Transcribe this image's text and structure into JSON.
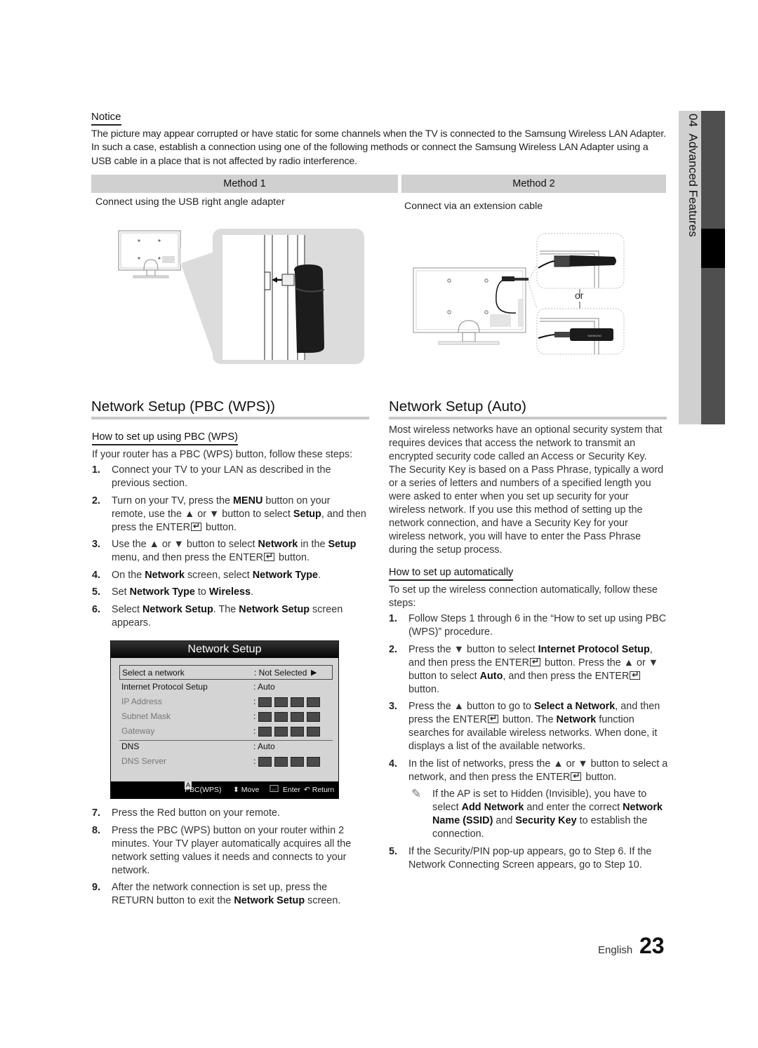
{
  "notice": {
    "title": "Notice",
    "text": "The picture may appear corrupted or have static for some channels when the TV is connected to the Samsung Wireless LAN Adapter. In such a case, establish a connection using one of the following methods or connect the Samsung Wireless LAN Adapter using a USB cable in a place that is not affected by radio interference."
  },
  "methods": [
    {
      "label": "Method 1",
      "desc": "Connect using the USB right angle adapter"
    },
    {
      "label": "Method 2",
      "desc": "Connect via an extension cable",
      "or_label": "or",
      "brand_label": "SAMSUNG"
    }
  ],
  "sidetab": {
    "chapter": "04",
    "title": "Advanced Features"
  },
  "pbc": {
    "title": "Network Setup (PBC (WPS))",
    "subtitle": "How to set up using PBC (WPS)",
    "intro": "If your router has a PBC (WPS) button, follow these steps:",
    "steps_a": [
      {
        "num": "1.",
        "html": "Connect your TV to your LAN as described in the previous section."
      },
      {
        "num": "2.",
        "html": "Turn on your TV, press the <b>MENU</b> button on your remote, use the ▲ or ▼ button to select <b>Setup</b>, and then press the ENTER<span class='enter-glyph'></span> button."
      },
      {
        "num": "3.",
        "html": "Use the ▲ or ▼ button to select <b>Network</b> in the <b>Setup</b> menu, and then press the ENTER<span class='enter-glyph'></span> button."
      },
      {
        "num": "4.",
        "html": "On the <b>Network</b> screen, select <b>Network Type</b>."
      },
      {
        "num": "5.",
        "html": "Set <b>Network Type</b> to <b>Wireless</b>."
      },
      {
        "num": "6.",
        "html": "Select <b>Network Setup</b>. The <b>Network Setup</b> screen appears."
      }
    ],
    "steps_b": [
      {
        "num": "7.",
        "html": "Press the Red button on your remote."
      },
      {
        "num": "8.",
        "html": "Press the PBC (WPS) button on your router within 2 minutes. Your TV player automatically acquires all the network setting values it needs and connects to your network."
      },
      {
        "num": "9.",
        "html": "After the network connection is set up, press the RETURN button to exit the <b>Network Setup</b> screen."
      }
    ]
  },
  "osd": {
    "title": "Network Setup",
    "rows": [
      {
        "label": "Select a network",
        "value": ": Not Selected",
        "arrow": "▶"
      },
      {
        "label": "Internet Protocol Setup",
        "value": ": Auto"
      },
      {
        "label": "IP Address",
        "value": ":"
      },
      {
        "label": "Subnet Mask",
        "value": ":"
      },
      {
        "label": "Gateway",
        "value": ":"
      },
      {
        "label": "DNS",
        "value": ": Auto"
      },
      {
        "label": "DNS Server",
        "value": ":"
      }
    ],
    "footer": {
      "a_key": "A",
      "pbc": "PBC(WPS)",
      "move": "Move",
      "enter": "Enter",
      "return": "Return"
    }
  },
  "auto": {
    "title": "Network Setup (Auto)",
    "intro": "Most wireless networks have an optional security system that requires devices that access the network to transmit an encrypted security code called an Access or Security Key. The Security Key is based on a Pass Phrase, typically a word or a series of letters and numbers of a specified length you were asked to enter when you set up security for your wireless network.  If you use this method of setting up the network connection, and have a Security Key for your wireless network, you will have to enter the Pass Phrase during the setup process.",
    "subtitle": "How to set up automatically",
    "sub_intro": "To set up the wireless connection automatically, follow these steps:",
    "steps": [
      {
        "num": "1.",
        "html": "Follow Steps 1 through 6 in the “How to set up using PBC (WPS)” procedure."
      },
      {
        "num": "2.",
        "html": "Press the ▼ button to select <b>Internet Protocol Setup</b>, and then press the ENTER<span class='enter-glyph'></span> button. Press the ▲ or ▼ button to select <b>Auto</b>, and then press the ENTER<span class='enter-glyph'></span> button."
      },
      {
        "num": "3.",
        "html": "Press the ▲ button to go to <b>Select a Network</b>, and then press the ENTER<span class='enter-glyph'></span> button. The <b>Network</b> function searches for available wireless networks. When done, it displays a list of the available networks."
      },
      {
        "num": "4.",
        "html": "In the list of networks, press the ▲ or ▼ button to select a network, and then press the ENTER<span class='enter-glyph'></span> button."
      }
    ],
    "note": "If the AP is set to Hidden (Invisible), you have to select <b>Add Network</b> and enter the correct <b>Network Name (SSID)</b> and <b>Security Key</b> to establish the connection.",
    "step5": {
      "num": "5.",
      "html": "If the Security/PIN pop-up appears, go to Step 6. If the Network Connecting Screen appears, go to Step 10."
    }
  },
  "footer": {
    "language": "English",
    "page": "23"
  }
}
